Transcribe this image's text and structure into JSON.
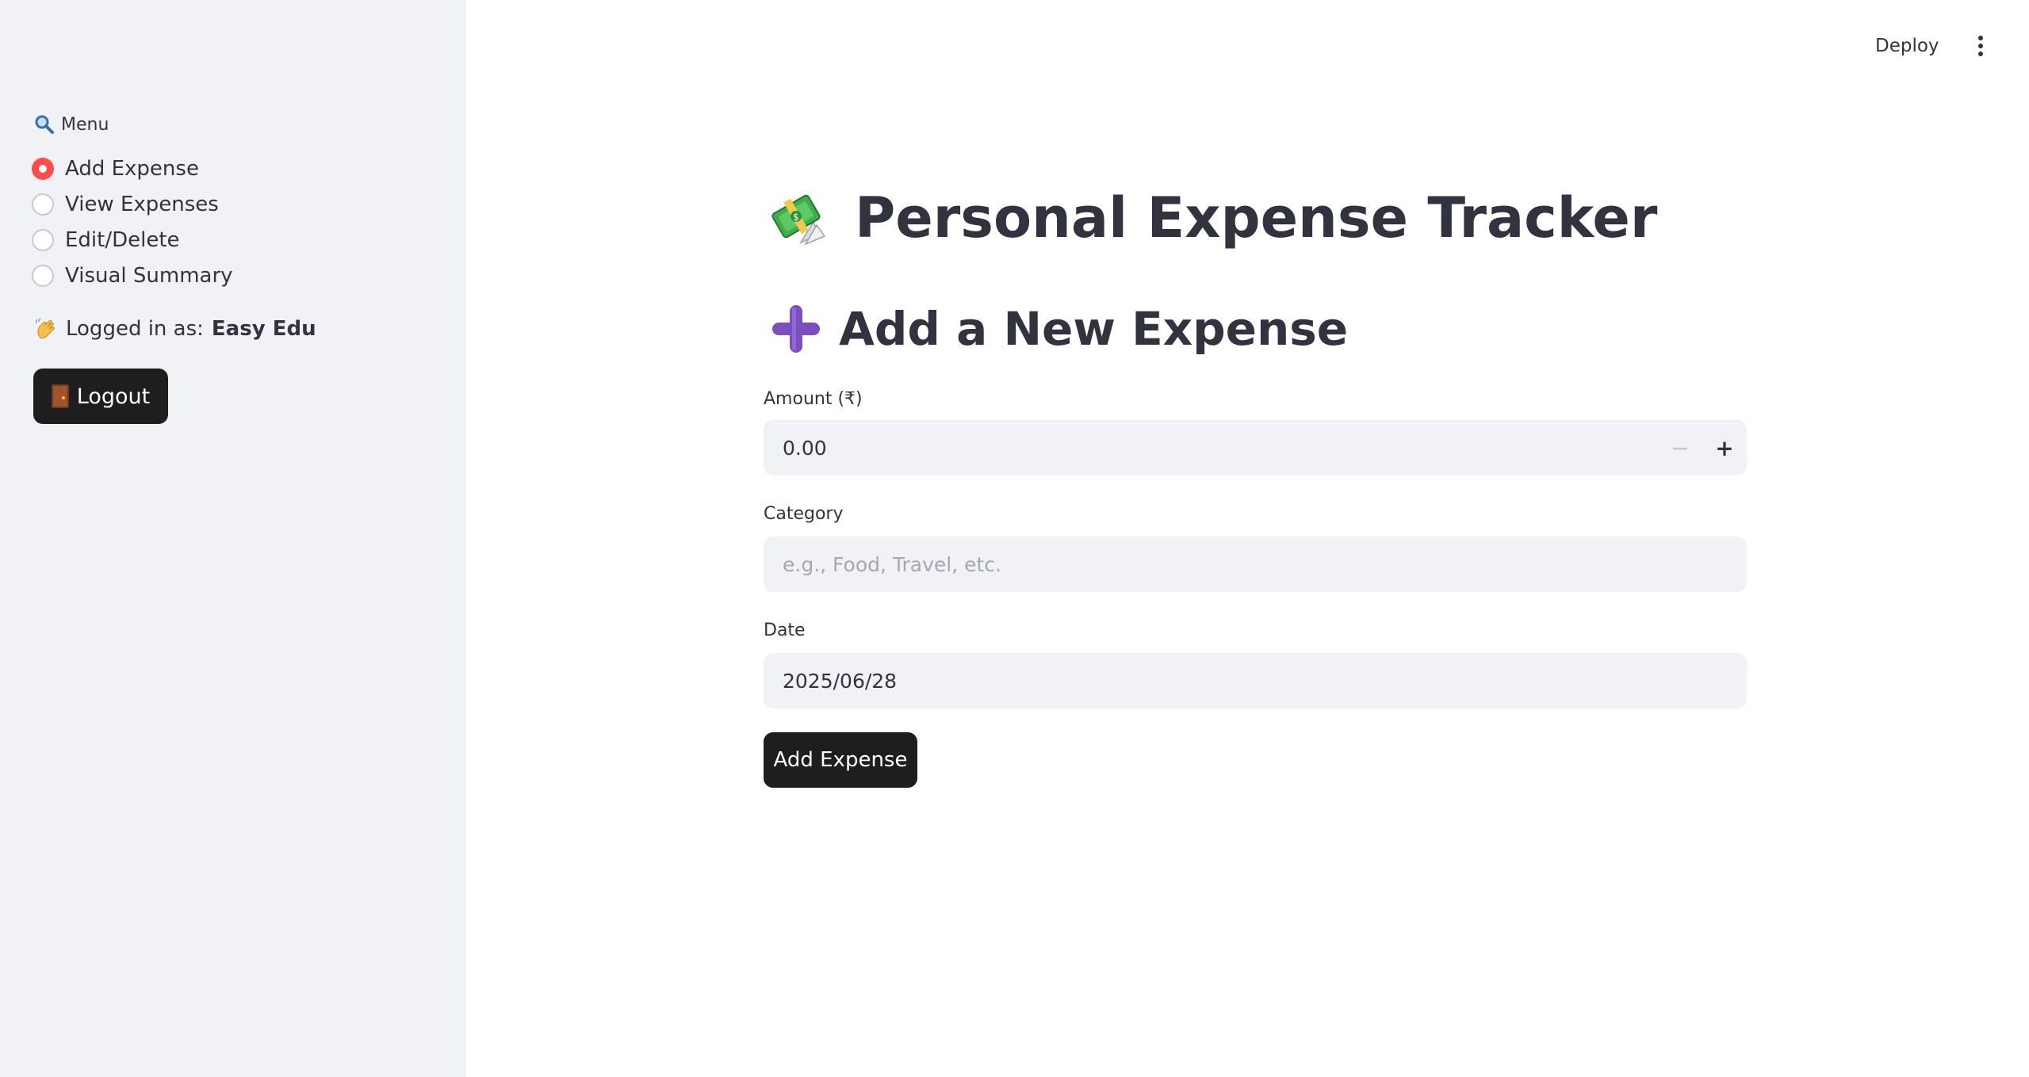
{
  "sidebar": {
    "menu_label": "Menu",
    "menu_icon": "magnifier-icon",
    "options": [
      {
        "label": "Add Expense",
        "selected": true
      },
      {
        "label": "View Expenses",
        "selected": false
      },
      {
        "label": "Edit/Delete",
        "selected": false
      },
      {
        "label": "Visual Summary",
        "selected": false
      }
    ],
    "logged_in_prefix": "Logged in as:",
    "logged_in_user": "Easy Edu",
    "logged_in_icon": "waving-hand-icon",
    "logout_label": "Logout",
    "logout_icon": "door-icon"
  },
  "header": {
    "deploy_label": "Deploy",
    "menu_icon": "kebab-menu-icon"
  },
  "main": {
    "title": "Personal Expense Tracker",
    "title_icon": "money-with-wings-icon",
    "subtitle": "Add a New Expense",
    "subtitle_icon": "plus-icon",
    "amount_label": "Amount (₹)",
    "amount_value": "0.00",
    "category_label": "Category",
    "category_placeholder": "e.g., Food, Travel, etc.",
    "category_value": "",
    "date_label": "Date",
    "date_value": "2025/06/28",
    "submit_label": "Add Expense"
  },
  "colors": {
    "sidebar_bg": "#f0f2f6",
    "accent_red": "#ff4b4b",
    "button_dark": "#1e1e1e",
    "text": "#31333f",
    "input_bg": "#f0f2f6",
    "subtitle_icon_purple": "#7b4fc0"
  }
}
